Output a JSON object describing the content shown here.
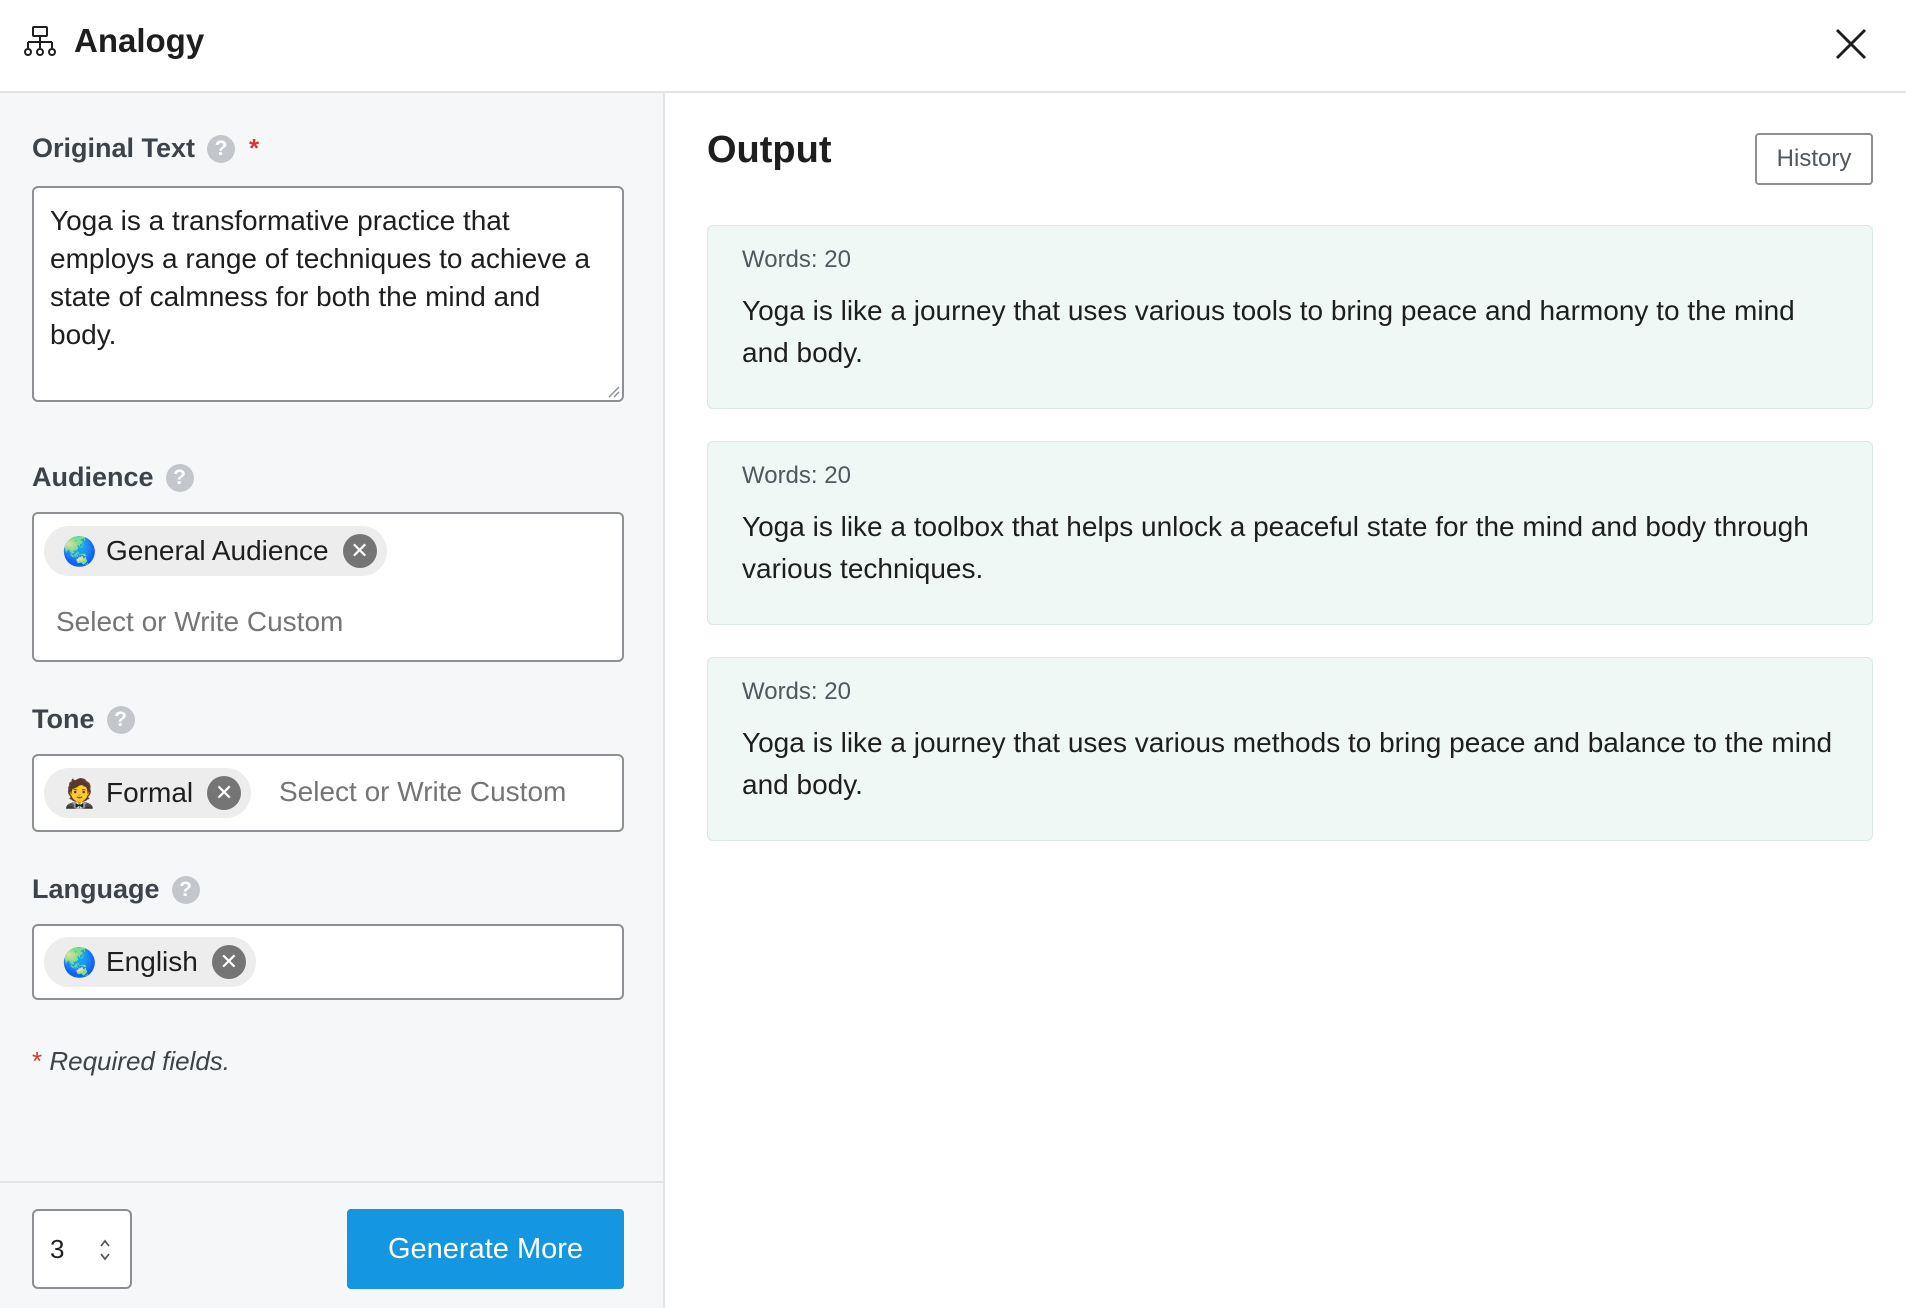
{
  "header": {
    "title": "Analogy",
    "app_icon": "sitemap-icon",
    "close_icon": "close-icon"
  },
  "form": {
    "original_text": {
      "label": "Original Text",
      "value": "Yoga is a transformative practice that employs a range of techniques to achieve a state of calmness for both the mind and body."
    },
    "audience": {
      "label": "Audience",
      "selected": [
        {
          "emoji": "🌏",
          "label": "General Audience"
        }
      ],
      "placeholder": "Select or Write Custom"
    },
    "tone": {
      "label": "Tone",
      "selected": [
        {
          "emoji": "🤵",
          "label": "Formal"
        }
      ],
      "placeholder": "Select or Write Custom"
    },
    "language": {
      "label": "Language",
      "selected": [
        {
          "emoji": "🌏",
          "label": "English"
        }
      ]
    },
    "help_symbol": "?",
    "required_star": "*",
    "required_note": "Required fields."
  },
  "footer": {
    "count_value": "3",
    "generate_label": "Generate More"
  },
  "output": {
    "title": "Output",
    "history_label": "History",
    "results": [
      {
        "words": "Words: 20",
        "text": "Yoga is like a journey that uses various tools to bring peace and harmony to the mind and body."
      },
      {
        "words": "Words: 20",
        "text": "Yoga is like a toolbox that helps unlock a peaceful state for the mind and body through various techniques."
      },
      {
        "words": "Words: 20",
        "text": "Yoga is like a journey that uses various methods to bring peace and balance to the mind and body."
      }
    ]
  },
  "colors": {
    "primary": "#1496e0",
    "required": "#d63638",
    "card_bg": "#f0f8f5"
  }
}
